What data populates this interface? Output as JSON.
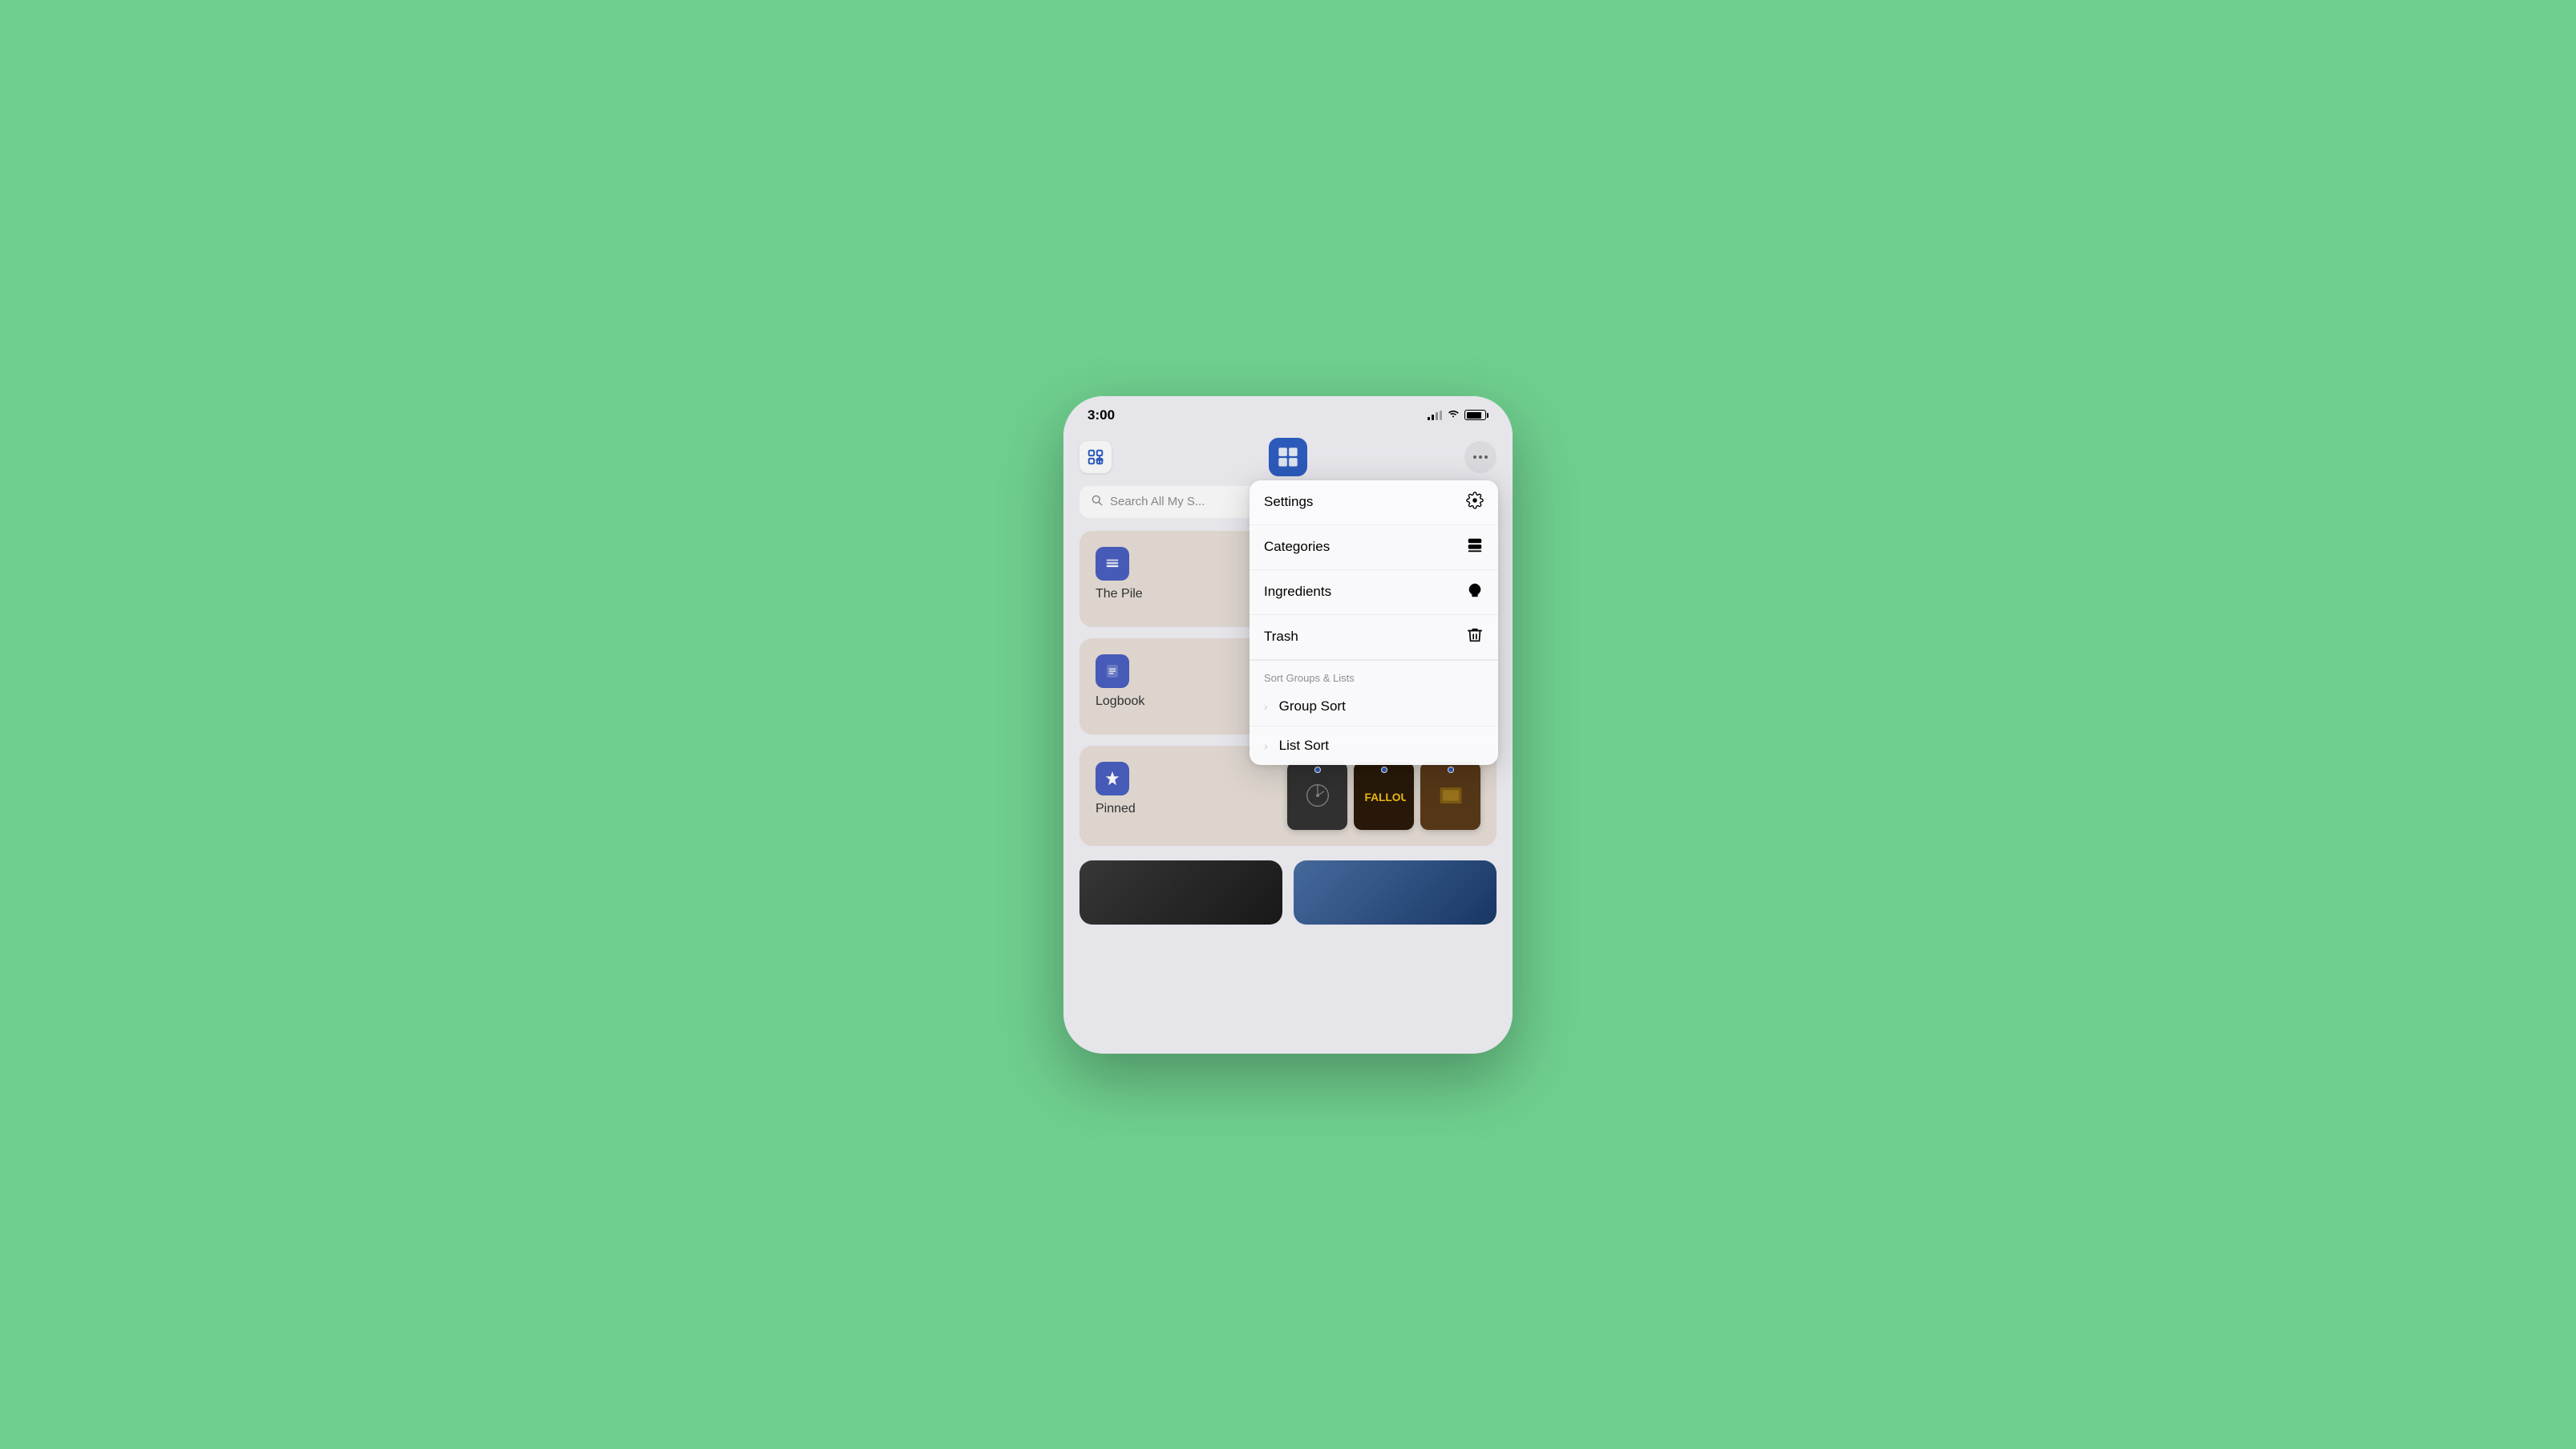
{
  "statusBar": {
    "time": "3:00"
  },
  "header": {
    "addButton": "add",
    "moreButton": "more"
  },
  "search": {
    "placeholder": "Search All My S..."
  },
  "groups": [
    {
      "name": "The Pile",
      "icon": "pile"
    },
    {
      "name": "Logbook",
      "icon": "logbook"
    },
    {
      "name": "Pinned",
      "icon": "pin"
    }
  ],
  "dropdown": {
    "items": [
      {
        "label": "Settings",
        "icon": "⚙️",
        "iconText": "🎛"
      },
      {
        "label": "Categories",
        "icon": "📦",
        "iconText": "📚"
      },
      {
        "label": "Ingredients",
        "icon": "🍳",
        "iconText": "🥘"
      },
      {
        "label": "Trash",
        "icon": "🗑️",
        "iconText": "🗑"
      }
    ],
    "sectionHeader": "Sort Groups & Lists",
    "sortItems": [
      {
        "label": "Group Sort"
      },
      {
        "label": "List Sort"
      }
    ]
  }
}
